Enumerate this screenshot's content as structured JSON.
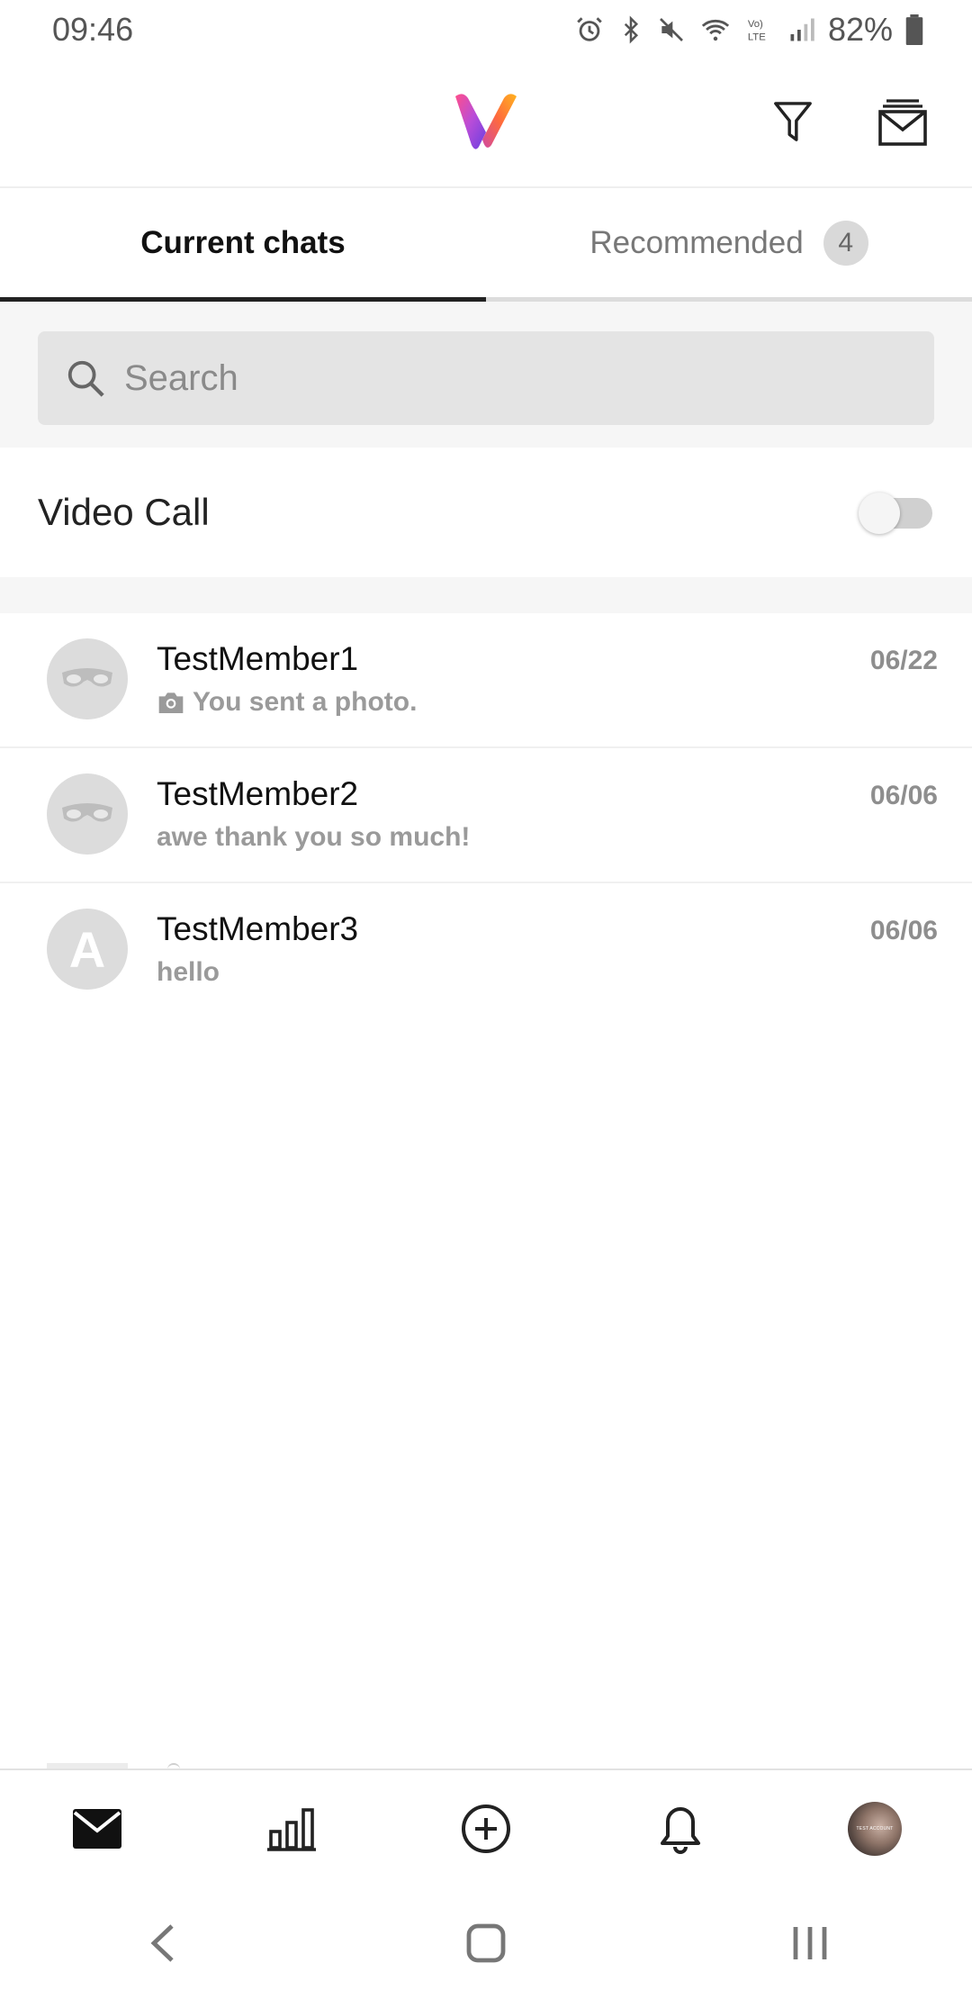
{
  "status_bar": {
    "time": "09:46",
    "battery": "82%"
  },
  "colors": {
    "accent_dark": "#222222",
    "badge_bg": "#d9d9d9",
    "muted_text": "#9a9a9a"
  },
  "header": {
    "logo_icon": "v-logo-icon",
    "filter_icon": "filter-icon",
    "mail_icon": "mail-stack-icon"
  },
  "tabs": [
    {
      "label": "Current chats",
      "active": true
    },
    {
      "label": "Recommended",
      "active": false,
      "badge": "4"
    }
  ],
  "search": {
    "placeholder": "Search",
    "value": ""
  },
  "video_call": {
    "label": "Video Call",
    "enabled": false
  },
  "chats": [
    {
      "name": "TestMember1",
      "preview": "You sent a photo.",
      "date": "06/22",
      "avatar": "masked-placeholder-icon",
      "preview_icon": "camera-icon"
    },
    {
      "name": "TestMember2",
      "preview": "awe thank you so much!",
      "date": "06/06",
      "avatar": "masked-placeholder-icon"
    },
    {
      "name": "TestMember3",
      "preview": "hello",
      "date": "06/06",
      "avatar_letter": "A"
    }
  ],
  "bottom_nav": {
    "items": [
      "messages-icon",
      "stats-icon",
      "add-icon",
      "bell-icon",
      "profile-avatar"
    ],
    "profile_text": "TEST ACCOUNT"
  }
}
